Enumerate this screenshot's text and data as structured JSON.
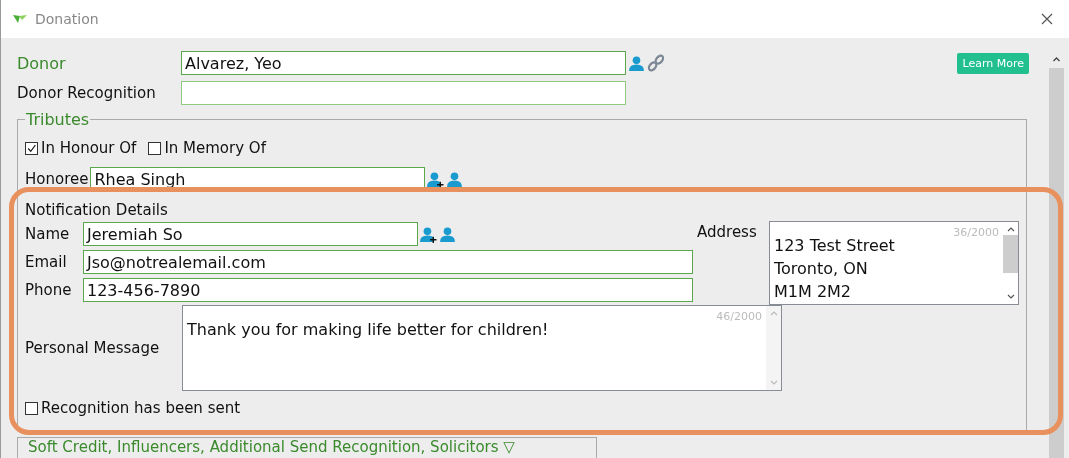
{
  "window": {
    "title": "Donation"
  },
  "learn_more": "Learn More",
  "donor": {
    "label": "Donor",
    "value": "Alvarez, Yeo"
  },
  "donor_recognition": {
    "label": "Donor Recognition"
  },
  "tributes": {
    "legend": "Tributes",
    "options": [
      {
        "label": "In Honour Of",
        "checked": true
      },
      {
        "label": "In Memory Of",
        "checked": false
      }
    ],
    "honoree": {
      "label": "Honoree",
      "value": "Rhea Singh"
    }
  },
  "notification": {
    "title": "Notification Details",
    "name": {
      "label": "Name",
      "value": "Jeremiah So"
    },
    "email": {
      "label": "Email",
      "value": "Jso@notrealemail.com"
    },
    "phone": {
      "label": "Phone",
      "value": "123-456-7890"
    },
    "address": {
      "label": "Address",
      "counter": "36/2000",
      "lines": [
        "123 Test Street",
        "Toronto, ON",
        "M1M 2M2"
      ]
    },
    "message": {
      "label": "Personal Message",
      "counter": "46/2000",
      "value": "Thank you for making life better for children!"
    },
    "recognition_sent": {
      "label": "Recognition has been sent",
      "checked": false
    }
  },
  "collapsed_section": {
    "legend": "Soft Credit, Influencers, Additional Send Recognition, Solicitors",
    "toggle": "▽"
  }
}
